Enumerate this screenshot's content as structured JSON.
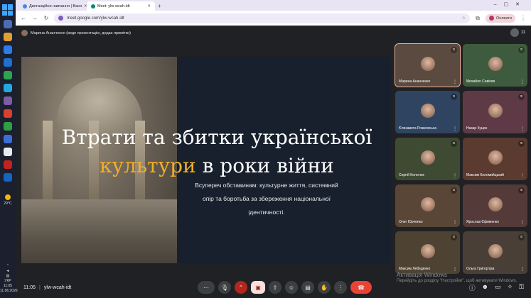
{
  "browser": {
    "tabs": [
      {
        "label": "Дистанційне навчання | Васи",
        "color": "#4285f4"
      },
      {
        "label": "Meet: ylw-wcah-idt",
        "color": "#00897b"
      }
    ],
    "new_tab": "+",
    "url": "meet.google.com/ylw-wcah-idt",
    "profile_label": "Оновити"
  },
  "meet": {
    "presenting_text": "Марина Ананченко (веде презентацію, додає примітки)",
    "participant_count": "11",
    "time": "11:05",
    "meeting_code": "ylw-wcah-idt"
  },
  "slide": {
    "title_line1": "Втрати та збитки української",
    "title_accent": "культури",
    "title_rest": " в роки війни",
    "subtitle": "Всупереч обставинам: культурне життя, системний опір та боротьба за збереження національної ідентичності."
  },
  "participants": [
    {
      "name": "Марина Ананченко",
      "tile_color": "#5b4a3f",
      "active": true
    },
    {
      "name": "Михайло Савіков",
      "tile_color": "#3f5b3f",
      "active": false
    },
    {
      "name": "Єлизавета Рожковська",
      "tile_color": "#2f4460",
      "active": false
    },
    {
      "name": "Назар Куцин",
      "tile_color": "#5e3a46",
      "active": false
    },
    {
      "name": "Сергій Колотюк",
      "tile_color": "#3f4a33",
      "active": false
    },
    {
      "name": "Максим Коломийцький",
      "tile_color": "#5b3a30",
      "active": false
    },
    {
      "name": "Олег Юрченко",
      "tile_color": "#5a4636",
      "active": false
    },
    {
      "name": "Ярослав Єфименко",
      "tile_color": "#553a3a",
      "active": false
    },
    {
      "name": "Максим Лебеденко",
      "tile_color": "#4e4232",
      "active": false
    },
    {
      "name": "Ольга Григор'єва",
      "tile_color": "#4a3f37",
      "active": false
    }
  ],
  "taskbar": {
    "weather": "29°C",
    "lang": "УКР",
    "clock_time": "11:05",
    "clock_date": "11.06.2026"
  },
  "watermark": {
    "line1": "Активація Windows",
    "line2": "Перейдіть до розділу \"Настройки\", щоб активувати Windows."
  }
}
